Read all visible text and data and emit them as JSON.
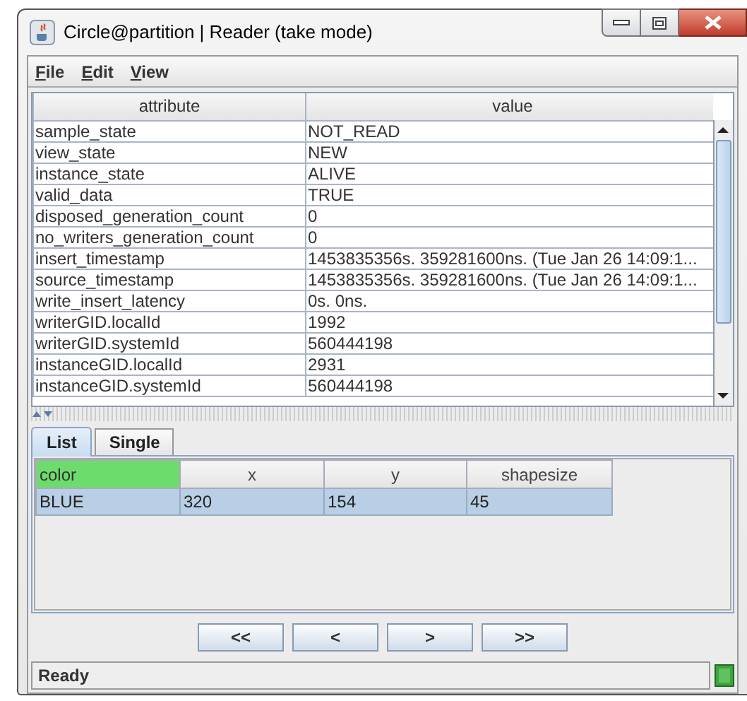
{
  "window": {
    "title": "Circle@partition | Reader (take mode)"
  },
  "menu": [
    {
      "mnemonic": "F",
      "rest": "ile"
    },
    {
      "mnemonic": "E",
      "rest": "dit"
    },
    {
      "mnemonic": "V",
      "rest": "iew"
    }
  ],
  "attributes_table": {
    "columns": [
      "attribute",
      "value"
    ],
    "rows": [
      {
        "attribute": "sample_state",
        "value": "NOT_READ"
      },
      {
        "attribute": "view_state",
        "value": "NEW"
      },
      {
        "attribute": "instance_state",
        "value": "ALIVE"
      },
      {
        "attribute": "valid_data",
        "value": "TRUE"
      },
      {
        "attribute": "disposed_generation_count",
        "value": "0"
      },
      {
        "attribute": "no_writers_generation_count",
        "value": "0"
      },
      {
        "attribute": "insert_timestamp",
        "value": "1453835356s. 359281600ns. (Tue Jan 26 14:09:1..."
      },
      {
        "attribute": "source_timestamp",
        "value": "1453835356s. 359281600ns. (Tue Jan 26 14:09:1..."
      },
      {
        "attribute": "write_insert_latency",
        "value": "0s. 0ns."
      },
      {
        "attribute": "writerGID.localId",
        "value": "1992"
      },
      {
        "attribute": "writerGID.systemId",
        "value": "560444198"
      },
      {
        "attribute": "instanceGID.localId",
        "value": "2931"
      },
      {
        "attribute": "instanceGID.systemId",
        "value": "560444198"
      }
    ]
  },
  "tabs": [
    {
      "label": "List",
      "selected": true
    },
    {
      "label": "Single",
      "selected": false
    }
  ],
  "samples_table": {
    "columns": [
      {
        "label": "color",
        "selected": true
      },
      {
        "label": "x",
        "selected": false
      },
      {
        "label": "y",
        "selected": false
      },
      {
        "label": "shapesize",
        "selected": false
      }
    ],
    "rows": [
      {
        "cells": [
          "BLUE",
          "320",
          "154",
          "45"
        ],
        "selected": true
      }
    ]
  },
  "nav_buttons": [
    "<<",
    "<",
    ">",
    ">>"
  ],
  "status_bar": {
    "text": "Ready"
  }
}
